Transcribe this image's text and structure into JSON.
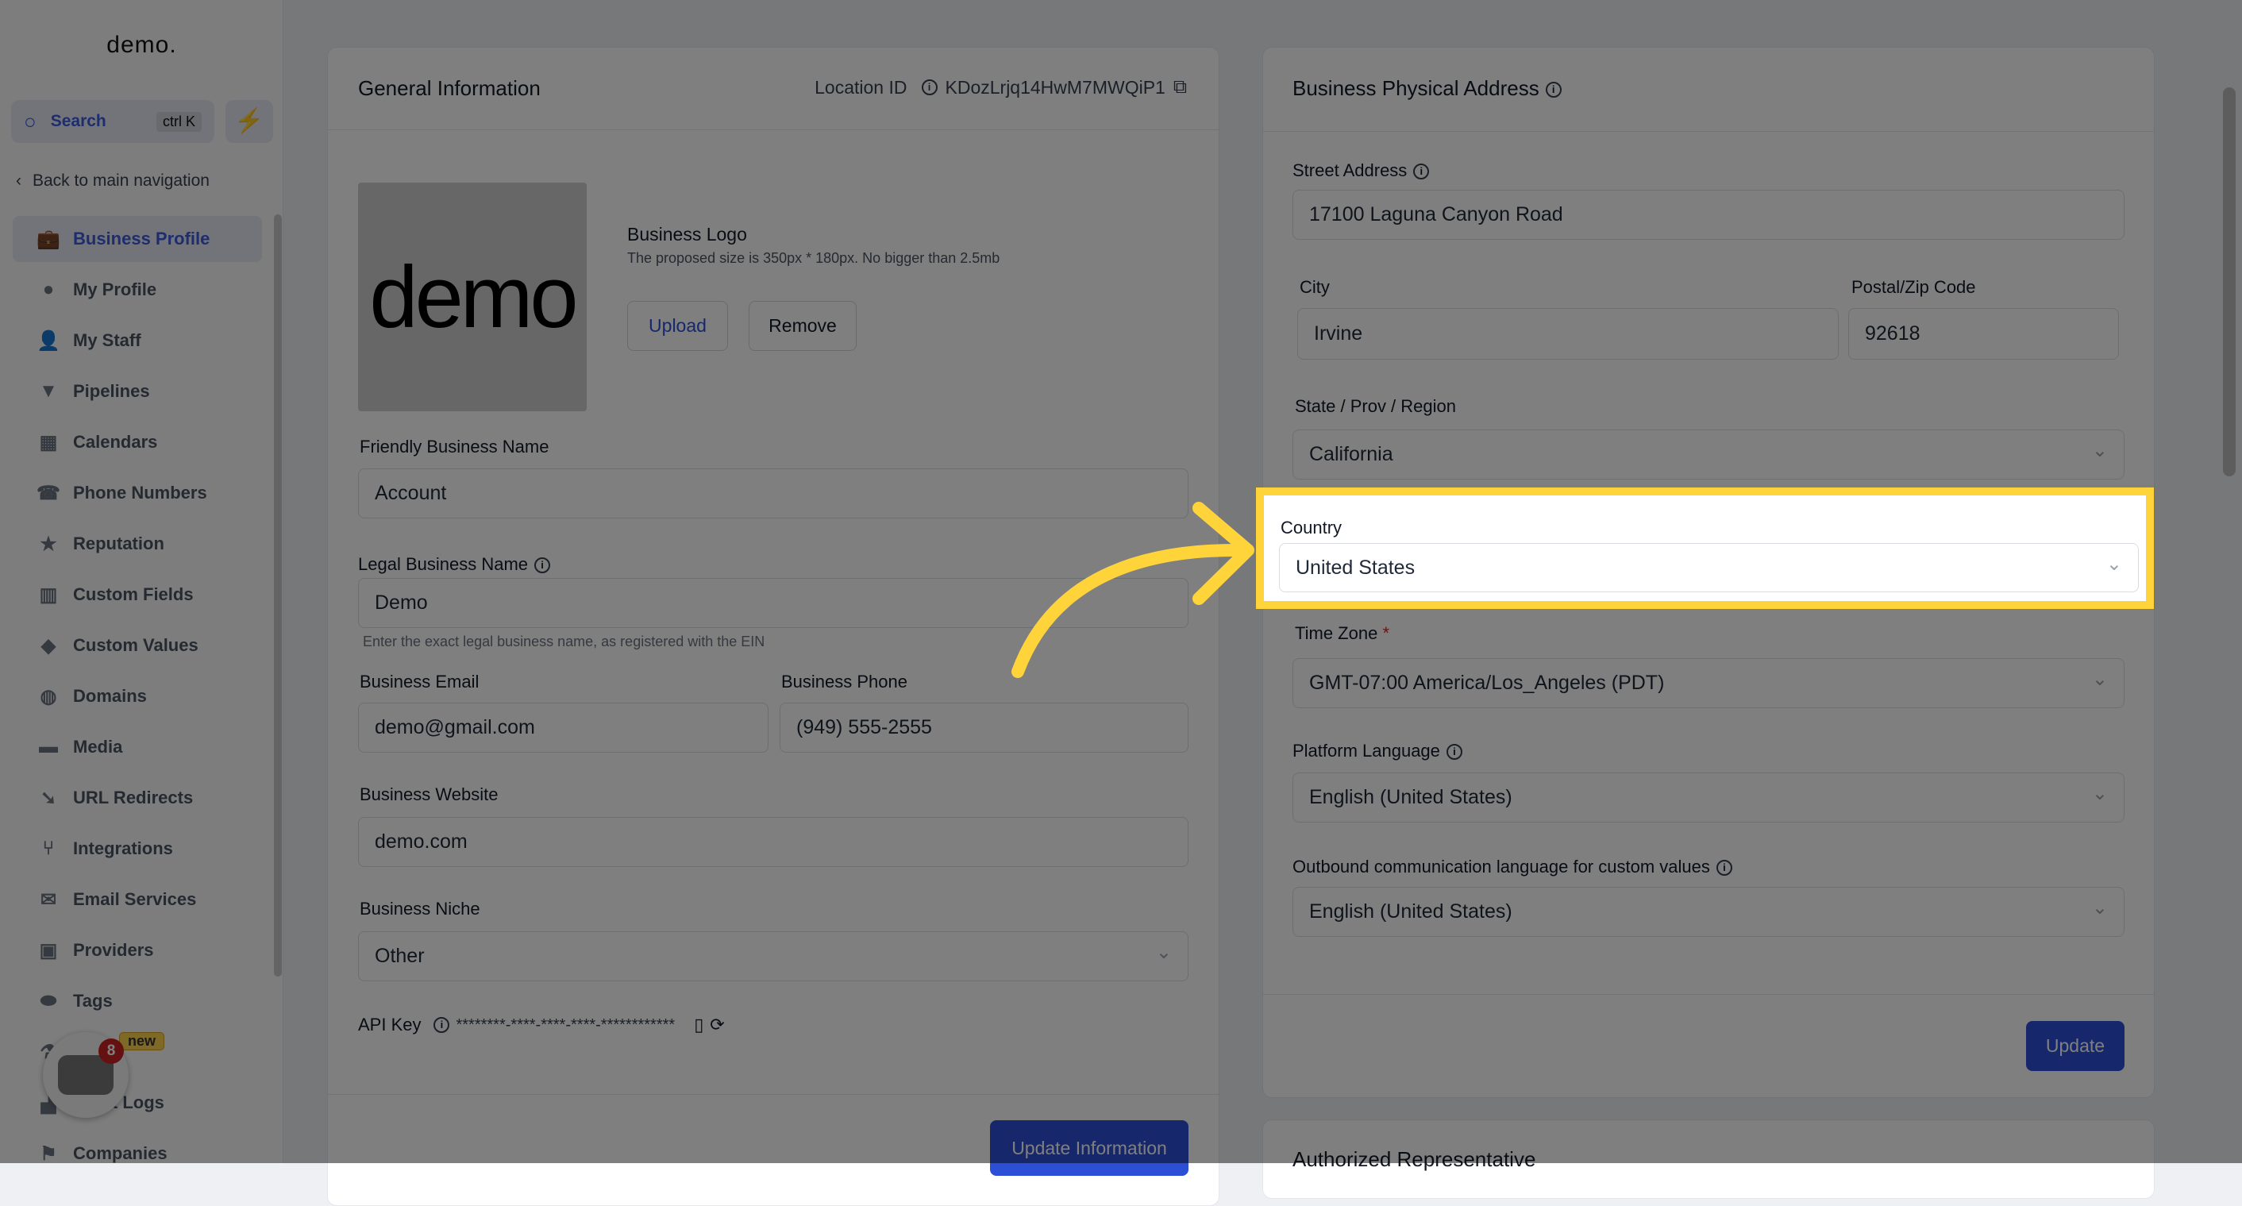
{
  "sidebar": {
    "logo": "demo.",
    "search_label": "Search",
    "search_shortcut": "ctrl K",
    "back_label": "Back to main navigation",
    "items": [
      {
        "label": "Business Profile",
        "icon": "briefcase-icon",
        "glyph": "💼",
        "active": true
      },
      {
        "label": "My Profile",
        "icon": "user-circle-icon",
        "glyph": "●"
      },
      {
        "label": "My Staff",
        "icon": "user-icon",
        "glyph": "👤"
      },
      {
        "label": "Pipelines",
        "icon": "filter-icon",
        "glyph": "▼"
      },
      {
        "label": "Calendars",
        "icon": "calendar-icon",
        "glyph": "▦"
      },
      {
        "label": "Phone Numbers",
        "icon": "phone-icon",
        "glyph": "☎"
      },
      {
        "label": "Reputation",
        "icon": "star-icon",
        "glyph": "★"
      },
      {
        "label": "Custom Fields",
        "icon": "fields-icon",
        "glyph": "▥"
      },
      {
        "label": "Custom Values",
        "icon": "diamond-icon",
        "glyph": "◆"
      },
      {
        "label": "Domains",
        "icon": "globe-icon",
        "glyph": "◍"
      },
      {
        "label": "Media",
        "icon": "video-icon",
        "glyph": "▬"
      },
      {
        "label": "URL Redirects",
        "icon": "redirect-icon",
        "glyph": "➘"
      },
      {
        "label": "Integrations",
        "icon": "integrations-icon",
        "glyph": "⑂"
      },
      {
        "label": "Email Services",
        "icon": "email-icon",
        "glyph": "✉"
      },
      {
        "label": "Providers",
        "icon": "clipboard-icon",
        "glyph": "▣"
      },
      {
        "label": "Tags",
        "icon": "tag-icon",
        "glyph": "⬬"
      },
      {
        "label": "",
        "icon": "flask-icon",
        "glyph": "⚗"
      },
      {
        "label": "Audit Logs",
        "icon": "chart-icon",
        "glyph": "▟"
      },
      {
        "label": "Companies",
        "icon": "flag-icon",
        "glyph": "⚑"
      }
    ],
    "new_badge": "new",
    "chat_badge_count": "8"
  },
  "general": {
    "title": "General Information",
    "location_id_label": "Location ID",
    "location_id": "KDozLrjq14HwM7MWQiP1",
    "logo_image_text": "demo",
    "logo_title": "Business Logo",
    "logo_hint": "The proposed size is 350px * 180px. No bigger than 2.5mb",
    "upload_label": "Upload",
    "remove_label": "Remove",
    "friendly_name_label": "Friendly Business Name",
    "friendly_name": "Account",
    "legal_name_label": "Legal Business Name",
    "legal_name": "Demo",
    "legal_name_help": "Enter the exact legal business name, as registered with the EIN",
    "email_label": "Business Email",
    "email": "demo@gmail.com",
    "phone_label": "Business Phone",
    "phone": "(949) 555-2555",
    "website_label": "Business Website",
    "website": "demo.com",
    "niche_label": "Business Niche",
    "niche": "Other",
    "api_key_label": "API Key",
    "api_key": "********-****-****-****-************",
    "update_label": "Update Information"
  },
  "address": {
    "title": "Business Physical Address",
    "street_label": "Street Address",
    "street": "17100 Laguna Canyon Road",
    "city_label": "City",
    "city": "Irvine",
    "postal_label": "Postal/Zip Code",
    "postal": "92618",
    "state_label": "State / Prov / Region",
    "state": "California",
    "country_label": "Country",
    "country": "United States",
    "timezone_label": "Time Zone",
    "timezone_required": "*",
    "timezone": "GMT-07:00 America/Los_Angeles (PDT)",
    "platform_lang_label": "Platform Language",
    "platform_lang": "English (United States)",
    "outbound_lang_label": "Outbound communication language for custom values",
    "outbound_lang": "English (United States)",
    "update_label": "Update"
  },
  "authorized": {
    "title": "Authorized Representative"
  },
  "colors": {
    "accent": "#2c4fd6",
    "highlight": "#ffd43b",
    "required": "#dc2626"
  }
}
